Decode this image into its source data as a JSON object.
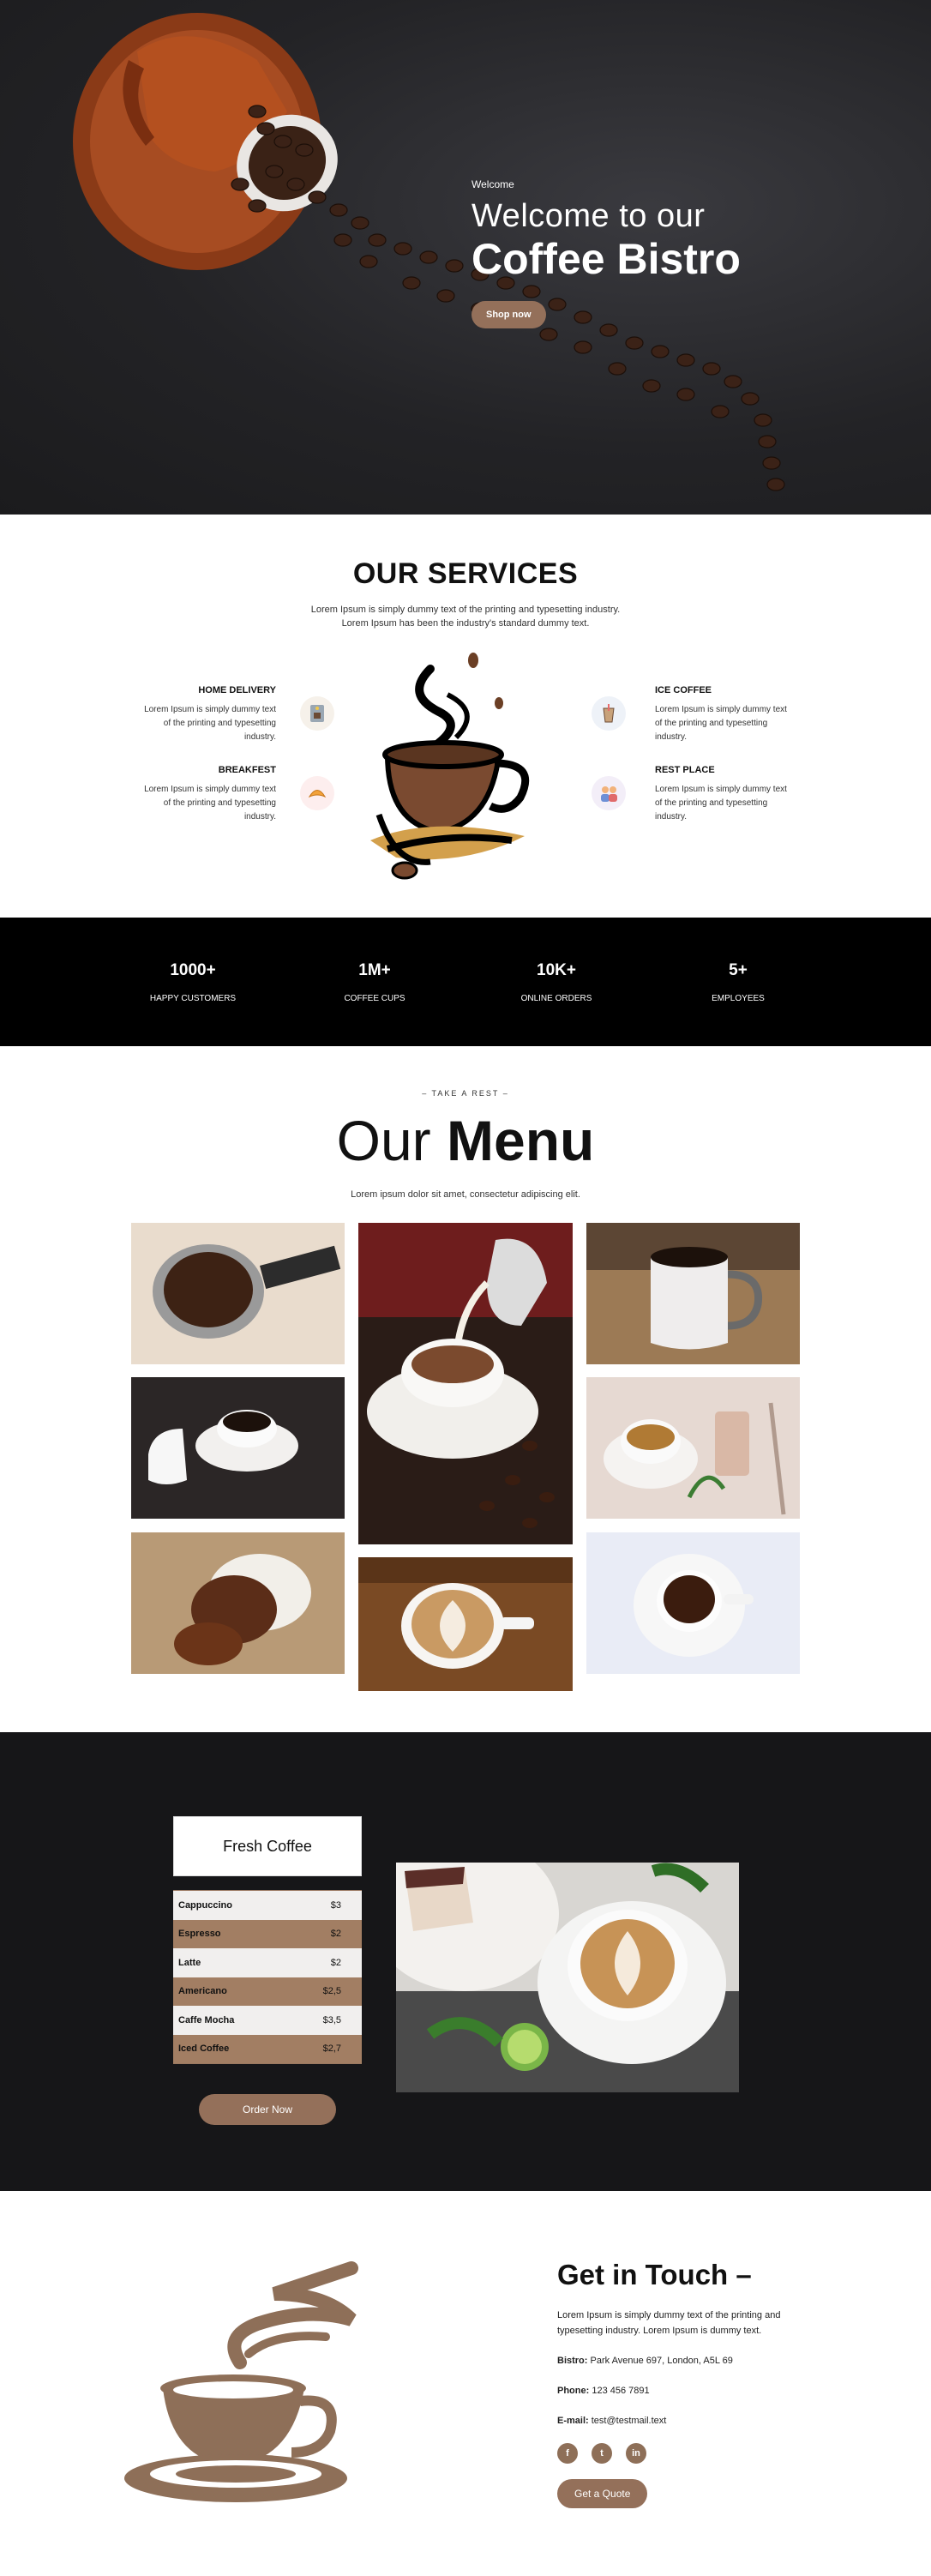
{
  "hero": {
    "eyebrow": "Welcome",
    "title_light": "Welcome to our",
    "title_bold": "Coffee Bistro",
    "cta": "Shop now"
  },
  "services": {
    "title": "OUR SERVICES",
    "subtitle_line1": "Lorem Ipsum is simply dummy text of the printing and typesetting industry.",
    "subtitle_line2": "Lorem Ipsum has been the industry's standard dummy text.",
    "items": [
      {
        "title": "HOME DELIVERY",
        "desc": "Lorem Ipsum is simply dummy text of the printing and typesetting industry.",
        "icon": "coffee-machine-icon"
      },
      {
        "title": "BREAKFEST",
        "desc": "Lorem Ipsum is simply dummy text of the printing and typesetting industry.",
        "icon": "croissant-icon"
      },
      {
        "title": "ICE COFFEE",
        "desc": "Lorem Ipsum is simply dummy text of the printing and typesetting industry.",
        "icon": "iced-coffee-icon"
      },
      {
        "title": "REST PLACE",
        "desc": "Lorem Ipsum is simply dummy text of the printing and typesetting industry.",
        "icon": "people-icon"
      }
    ]
  },
  "stats": [
    {
      "num": "1000+",
      "label": "HAPPY CUSTOMERS"
    },
    {
      "num": "1M+",
      "label": "COFFEE CUPS"
    },
    {
      "num": "10K+",
      "label": "ONLINE ORDERS"
    },
    {
      "num": "5+",
      "label": "EMPLOYEES"
    }
  ],
  "menu": {
    "eyebrow": "– TAKE A REST –",
    "title_light": "Our",
    "title_bold": "Menu",
    "subtitle": "Lorem ipsum dolor sit amet, consectetur adipiscing elit."
  },
  "fresh": {
    "heading": "Fresh Coffee",
    "items": [
      {
        "name": "Cappuccino",
        "price": "$3"
      },
      {
        "name": "Espresso",
        "price": "$2"
      },
      {
        "name": "Latte",
        "price": "$2"
      },
      {
        "name": "Americano",
        "price": "$2,5"
      },
      {
        "name": "Caffe Mocha",
        "price": "$3,5"
      },
      {
        "name": "Iced Coffee",
        "price": "$2,7"
      }
    ],
    "cta": "Order Now"
  },
  "contact": {
    "title": "Get in Touch –",
    "intro": "Lorem Ipsum is simply dummy text of the printing and typesetting industry. Lorem Ipsum is dummy text.",
    "address_label": "Bistro:",
    "address": "Park Avenue 697, London, A5L 69",
    "phone_label": "Phone:",
    "phone": "123 456 7891",
    "email_label": "E-mail:",
    "email": "test@testmail.text",
    "socials": [
      {
        "icon": "facebook-icon",
        "glyph": "f"
      },
      {
        "icon": "twitter-icon",
        "glyph": "t"
      },
      {
        "icon": "linkedin-icon",
        "glyph": "in"
      }
    ],
    "cta": "Get a Quote"
  },
  "colors": {
    "accent": "#94705a",
    "stats_bg": "#000000",
    "fresh_bg": "#161618"
  }
}
